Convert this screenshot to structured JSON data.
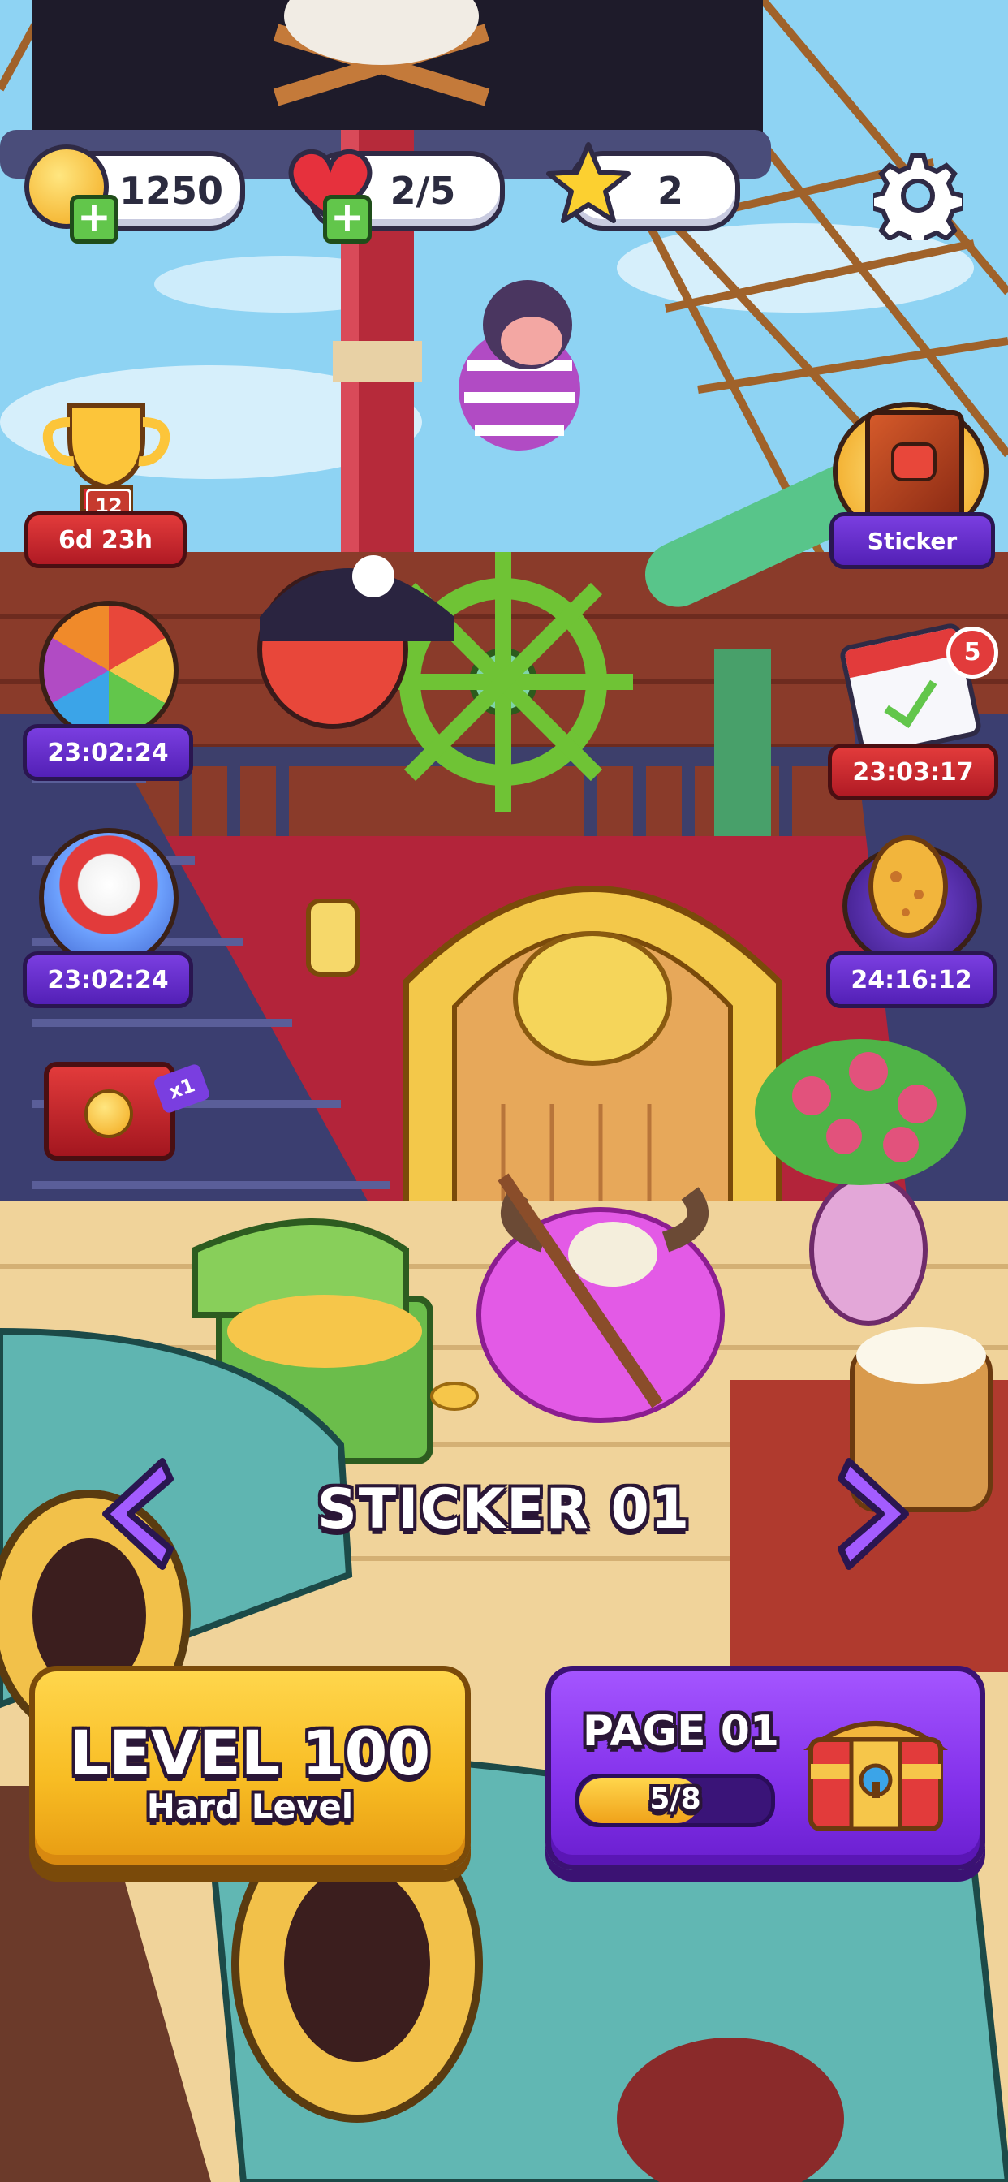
{
  "topbar": {
    "coins": "1250",
    "lives": "2/5",
    "stars": "2"
  },
  "events": {
    "trophy": {
      "level": "12",
      "timer": "6d 23h"
    },
    "sticker": {
      "label": "Sticker"
    },
    "wheel": {
      "timer": "23:02:24"
    },
    "calendar": {
      "timer": "23:03:17",
      "badge": "5"
    },
    "balloon": {
      "timer": "23:02:24"
    },
    "egg": {
      "timer": "24:16:12"
    },
    "offer": {
      "multiplier": "x1"
    }
  },
  "scene": {
    "title": "STICKER 01"
  },
  "level_button": {
    "title": "LEVEL 100",
    "subtitle": "Hard Level"
  },
  "page_button": {
    "title": "PAGE 01",
    "progress_text": "5/8",
    "progress": 0.625
  },
  "colors": {
    "sky": "#8ed3f3",
    "deck": "#f3d9a4",
    "hull_red": "#b3243a",
    "level_yellow": "#f8bd24",
    "page_purple": "#8230ea"
  }
}
